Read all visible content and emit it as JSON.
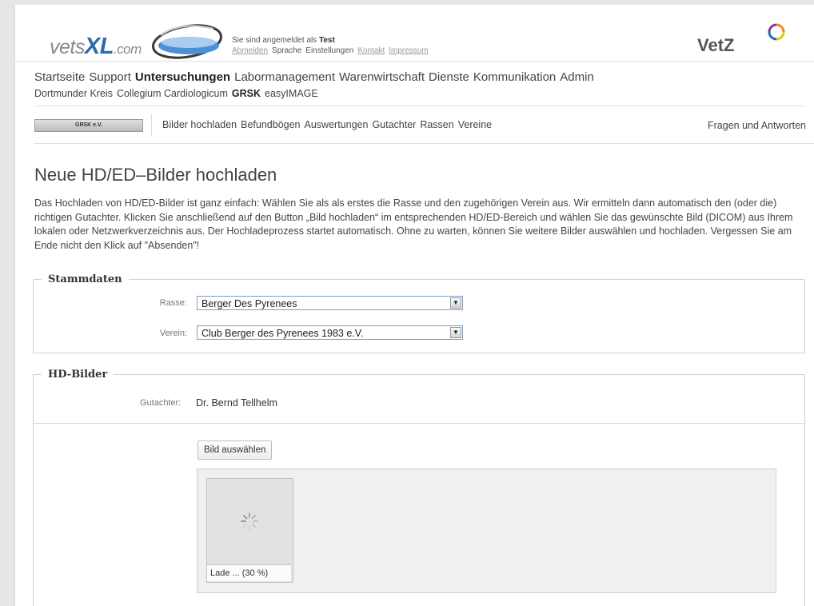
{
  "header": {
    "logo": {
      "prefix": "vets",
      "xl": "XL",
      "suffix": ".com"
    },
    "user_line": "Sie sind angemeldet als",
    "user_name": "Test",
    "links": [
      "Abmelden",
      "Sprache",
      "Einstellungen",
      "Kontakt",
      "Impressum"
    ],
    "brand_right": "VetZ"
  },
  "nav_main": [
    "Startseite",
    "Support",
    "Untersuchungen",
    "Labormanagement",
    "Warenwirtschaft",
    "Dienste",
    "Kommunikation",
    "Admin"
  ],
  "nav_sub": [
    "Dortmunder Kreis",
    "Collegium Cardiologicum",
    "GRSK",
    "easyIMAGE"
  ],
  "grsk_badge": "GRSK e.V.",
  "nav_grsk": [
    "Bilder hochladen",
    "Befundbögen",
    "Auswertungen",
    "Gutachter",
    "Rassen",
    "Vereine"
  ],
  "faq": "Fragen und Antworten",
  "page_title": "Neue HD/ED–Bilder hochladen",
  "intro": "Das Hochladen von HD/ED-Bilder ist ganz einfach: Wählen Sie als als erstes die Rasse und den zugehörigen Verein aus. Wir ermitteln dann automatisch den (oder die) richtigen Gutachter. Klicken Sie anschließend auf den Button „Bild hochladen“ im entsprechenden HD/ED-Bereich und wählen Sie das gewünschte Bild (DICOM) aus Ihrem lokalen oder Netzwerkverzeichnis aus. Der Hochladeprozess startet automatisch. Ohne zu warten, können Sie weitere Bilder auswählen und hochladen. Vergessen Sie am Ende nicht den Klick auf \"Absenden\"!",
  "stammdaten": {
    "legend": "Stammdaten",
    "rasse_label": "Rasse:",
    "rasse_value": "Berger Des Pyrenees",
    "verein_label": "Verein:",
    "verein_value": "Club Berger des Pyrenees 1983 e.V."
  },
  "hd": {
    "legend": "HD-Bilder",
    "gutachter_label": "Gutachter:",
    "gutachter_value": "Dr. Bernd Tellhelm",
    "select_button": "Bild auswählen",
    "upload_status": "Lade ... (30 %)",
    "upload_progress_percent": 30
  },
  "colors": {
    "logo_blue": "#2a6bb0",
    "vetz_orange": "#f08a1c",
    "vetz_purple": "#7a3e9d"
  }
}
